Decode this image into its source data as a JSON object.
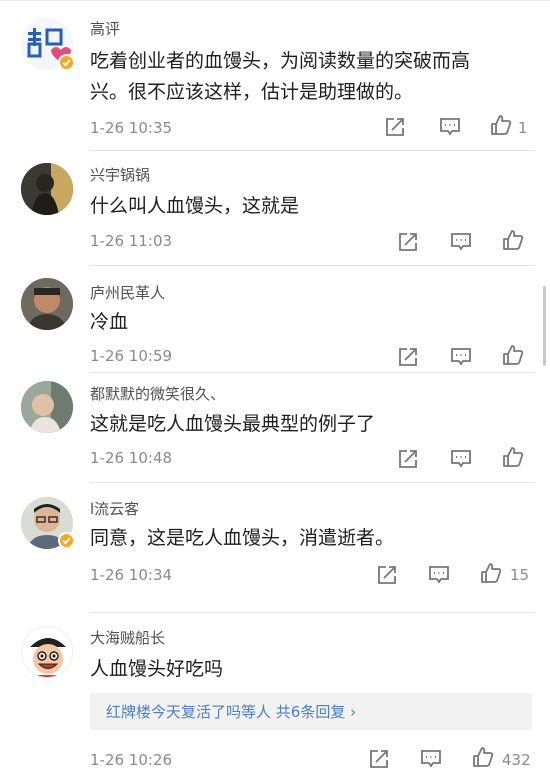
{
  "comments": [
    {
      "username": "高评",
      "text_lines": [
        "吃着创业者的血馒头，为阅读数量的突破而高",
        "兴。很不应该这样，估计是助理做的。"
      ],
      "time": "1-26 10:35",
      "likes": "1",
      "verified": true,
      "avatar": "qingniao-logo-avatar"
    },
    {
      "username": "兴宇锅锅",
      "text_lines": [
        "什么叫人血馒头，这就是"
      ],
      "time": "1-26 11:03",
      "likes": "",
      "verified": false,
      "avatar": "person-photo-avatar"
    },
    {
      "username": "庐州民革人",
      "text_lines": [
        "冷血"
      ],
      "time": "1-26 10:59",
      "likes": "",
      "verified": false,
      "avatar": "person-photo-avatar"
    },
    {
      "username": "都默默的微笑很久、",
      "text_lines": [
        "这就是吃人血馒头最典型的例子了"
      ],
      "time": "1-26 10:48",
      "likes": "",
      "verified": false,
      "avatar": "child-photo-avatar"
    },
    {
      "username": "l流云客",
      "text_lines": [
        "同意，这是吃人血馒头，消遣逝者。"
      ],
      "time": "1-26 10:34",
      "likes": "15",
      "verified": true,
      "avatar": "person-glasses-photo-avatar"
    },
    {
      "username": "大海贼船长",
      "text_lines": [
        "人血馒头好吃吗"
      ],
      "time": "1-26 10:26",
      "likes": "432",
      "verified": false,
      "avatar": "cartoon-pirate-avatar",
      "reply_summary": "红牌楼今天复活了吗等人  共6条回复 ›"
    }
  ],
  "icons": {
    "repost": "repost-icon",
    "comment": "comment-icon",
    "like": "thumbs-up-icon",
    "verified": "verified-badge-icon"
  },
  "colors": {
    "link": "#4a7fc1",
    "meta": "#8a8a8a",
    "verified": "#f5a623"
  }
}
